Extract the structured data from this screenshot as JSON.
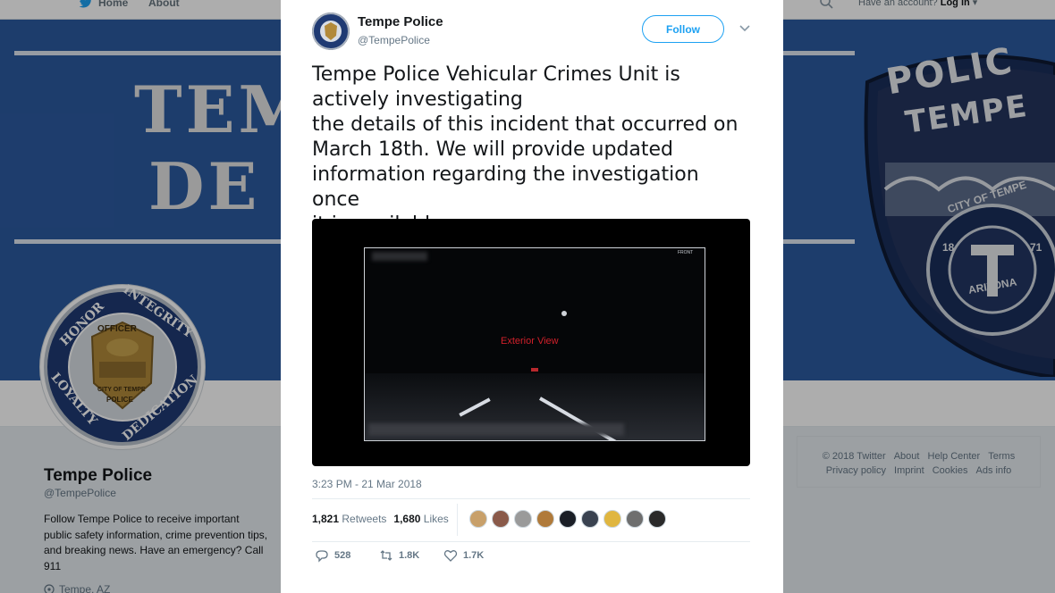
{
  "nav": {
    "home_label": "Home",
    "about_label": "About",
    "login_prompt": "Have an account?",
    "login_label": "Log in"
  },
  "banner": {
    "text_line1": "TEM",
    "text_line2": "DE",
    "patch_top": "POLIC",
    "patch_sub": "TEMPE",
    "patch_city": "CITY OF TEMPE",
    "patch_year_left": "18",
    "patch_year_right": "71",
    "patch_state": "ARIZONA"
  },
  "profile": {
    "name": "Tempe Police",
    "handle": "@TempePolice",
    "bio": "Follow Tempe Police to receive important public safety information, crime prevention tips, and breaking news. Have an emergency? Call 911",
    "location": "Tempe, AZ",
    "badge_words": [
      "HONOR",
      "INTEGRITY",
      "LOYALTY",
      "DEDICATION",
      "OFFICER",
      "CITY OF TEMPE",
      "POLICE"
    ]
  },
  "footer": {
    "links": [
      "© 2018 Twitter",
      "About",
      "Help Center",
      "Terms",
      "Privacy policy",
      "Imprint",
      "Cookies",
      "Ads info"
    ]
  },
  "tweet": {
    "author_name": "Tempe Police",
    "author_handle": "@TempePolice",
    "follow_label": "Follow",
    "text": "Tempe Police Vehicular Crimes Unit is\nactively investigating\nthe details of this incident that occurred on\nMarch 18th. We will provide updated\ninformation regarding the investigation once\nit is available.",
    "video_overlay": "Exterior View",
    "video_corner": "FRONT",
    "timestamp": "3:23 PM - 21 Mar 2018",
    "retweets_count": "1,821",
    "retweets_label": "Retweets",
    "likes_count": "1,680",
    "likes_label": "Likes",
    "reply_count": "528",
    "retweet_action_count": "1.8K",
    "like_action_count": "1.7K"
  },
  "colors": {
    "twitter_blue": "#1da1f2",
    "banner_blue": "#2c5aa0",
    "text_dark": "#14171a",
    "text_gray": "#657786",
    "video_label_red": "#d0202a"
  },
  "icons": {
    "nav_logo": "twitter-bird-icon",
    "search": "search-icon",
    "caret": "chevron-down-icon",
    "reply": "reply-icon",
    "retweet": "retweet-icon",
    "like": "heart-icon",
    "location": "location-pin-icon"
  }
}
